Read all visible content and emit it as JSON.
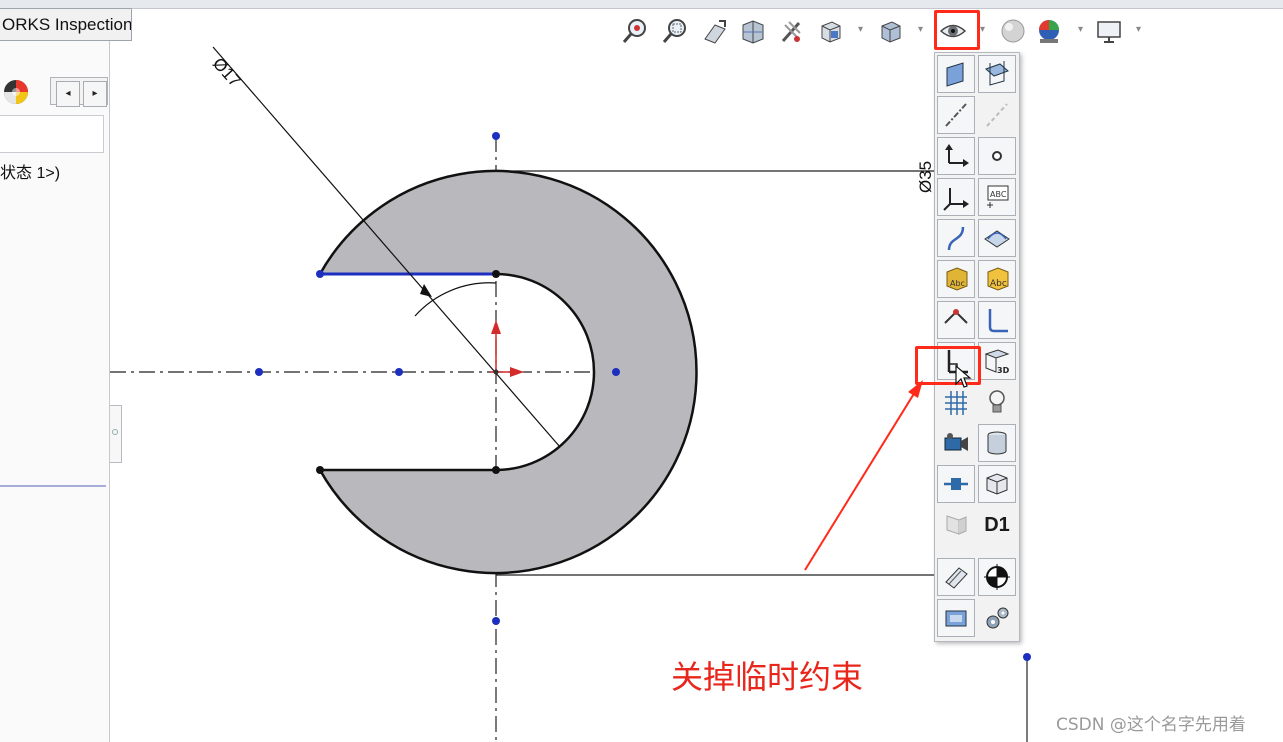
{
  "window": {
    "tab_title": "ORKS Inspection"
  },
  "left_panel": {
    "config_state_text": "状态 1>)",
    "nav_prev_label": "◂",
    "nav_next_label": "▸"
  },
  "sketch": {
    "dimension_diameter": "Ø17",
    "dimension_vertical": "Ø35"
  },
  "heads_up_toolbar": {
    "items": [
      {
        "name": "zoom-to-fit",
        "icon": "magnifier-zoom-fit-icon"
      },
      {
        "name": "zoom-to-area",
        "icon": "magnifier-zoom-area-icon"
      },
      {
        "name": "previous-view",
        "icon": "previous-view-icon"
      },
      {
        "name": "section-view",
        "icon": "section-view-icon"
      },
      {
        "name": "dynamic-annotation-views",
        "icon": "dynamic-annotation-icon"
      },
      {
        "name": "view-orientation",
        "icon": "view-orientation-cube-icon"
      },
      {
        "name": "display-style",
        "icon": "display-style-cube-icon"
      },
      {
        "name": "hide-show-items",
        "icon": "eye-icon"
      },
      {
        "name": "edit-appearance",
        "icon": "appearance-sphere-icon"
      },
      {
        "name": "apply-scene",
        "icon": "scene-ball-icon"
      },
      {
        "name": "view-settings",
        "icon": "monitor-icon"
      }
    ]
  },
  "hide_show_menu": {
    "items": [
      {
        "name": "view-planes",
        "icon": "plane-icon"
      },
      {
        "name": "view-all-planes",
        "icon": "all-planes-icon"
      },
      {
        "name": "view-axes",
        "icon": "axis-icon"
      },
      {
        "name": "view-temporary-axes",
        "icon": "temporary-axes-icon"
      },
      {
        "name": "view-origins",
        "icon": "origin-icon"
      },
      {
        "name": "view-points",
        "icon": "point-icon"
      },
      {
        "name": "view-coordinate-systems",
        "icon": "coordinate-system-icon"
      },
      {
        "name": "view-annotations",
        "icon": "annotation-icon"
      },
      {
        "name": "view-curves",
        "icon": "curve-icon"
      },
      {
        "name": "view-surfaces",
        "icon": "surface-icon"
      },
      {
        "name": "view-parting-lines",
        "icon": "parting-line-icon"
      },
      {
        "name": "view-decals",
        "icon": "decal-icon"
      },
      {
        "name": "view-routing-points",
        "icon": "routing-point-icon"
      },
      {
        "name": "view-sketches",
        "icon": "sketch-icon"
      },
      {
        "name": "view-sketch-relations",
        "icon": "sketch-relations-icon"
      },
      {
        "name": "view-3d-sketch-planes",
        "icon": "3d-sketch-plane-icon"
      },
      {
        "name": "view-grid",
        "icon": "grid-icon"
      },
      {
        "name": "view-lights",
        "icon": "lightbulb-icon"
      },
      {
        "name": "view-cameras",
        "icon": "camera-icon"
      },
      {
        "name": "view-bodies",
        "icon": "cylinder-icon"
      },
      {
        "name": "view-dimension-names",
        "icon": "dimension-name-icon"
      },
      {
        "name": "view-weld-beads",
        "icon": "weld-bead-icon"
      },
      {
        "name": "view-sheet-metal",
        "icon": "sheet-metal-icon"
      },
      {
        "name": "view-primary-dimensions",
        "label": "D1",
        "icon": "d1-icon"
      },
      {
        "name": "view-sketch-dimensions",
        "icon": "sketch-dimension-icon"
      },
      {
        "name": "view-center-of-mass",
        "icon": "center-of-mass-icon"
      },
      {
        "name": "view-mates",
        "icon": "mates-icon"
      },
      {
        "name": "view-gears",
        "icon": "gear-icon"
      }
    ]
  },
  "annotation": {
    "text": "关掉临时约束"
  },
  "watermark": {
    "text": "CSDN @这个名字先用着"
  },
  "colors": {
    "highlight": "#ff2a1a",
    "part_fill": "#b9b9bd",
    "sketch_blue": "#1d2fbf",
    "origin_red": "#d42a2a"
  }
}
